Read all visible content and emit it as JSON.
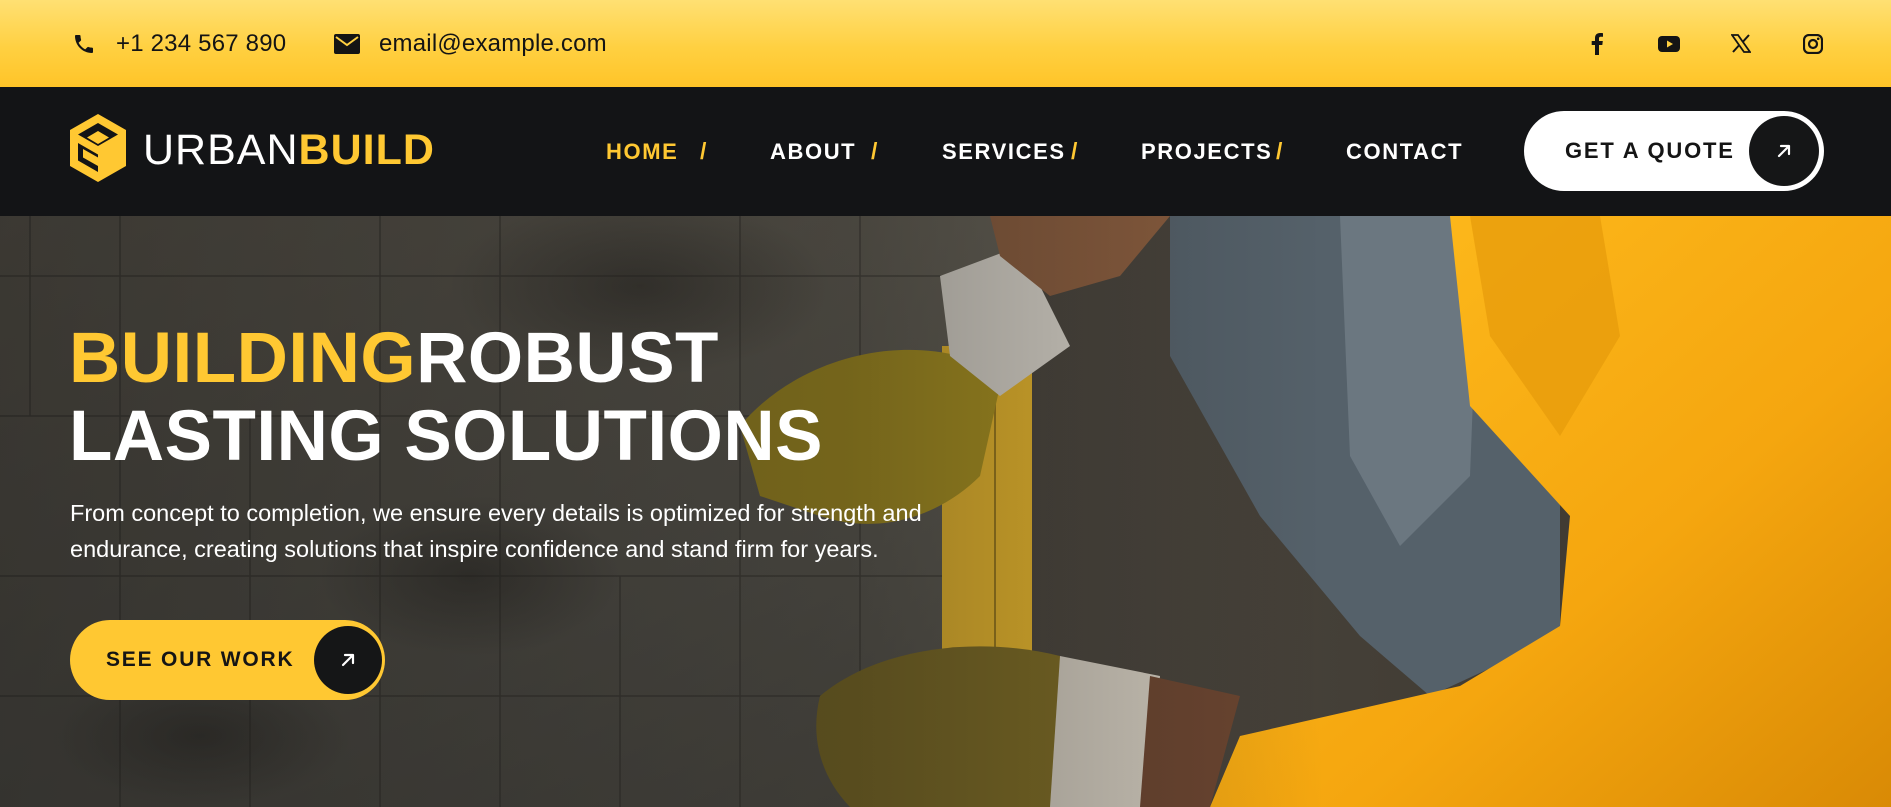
{
  "topbar": {
    "phone": "+1 234 567 890",
    "email": "email@example.com",
    "social": [
      "facebook-icon",
      "youtube-icon",
      "x-icon",
      "instagram-icon"
    ]
  },
  "brand": {
    "word1": "URBAN",
    "word2": "BUILD"
  },
  "nav": {
    "items": [
      {
        "label": "HOME",
        "active": true
      },
      {
        "label": "ABOUT",
        "active": false
      },
      {
        "label": "SERVICES",
        "active": false
      },
      {
        "label": "PROJECTS",
        "active": false
      },
      {
        "label": "CONTACT",
        "active": false
      }
    ],
    "separator": "/",
    "cta": "GET A QUOTE"
  },
  "hero": {
    "title_highlight": "BUILDING",
    "title_rest": "ROBUST",
    "title_line2": "LASTING SOLUTIONS",
    "subtitle": "From concept to completion, we ensure every details is optimized for strength and endurance, creating solutions that inspire confidence and stand firm for years.",
    "cta": "SEE OUR WORK"
  },
  "colors": {
    "accent": "#ffc832",
    "dark": "#131416",
    "white": "#ffffff"
  }
}
